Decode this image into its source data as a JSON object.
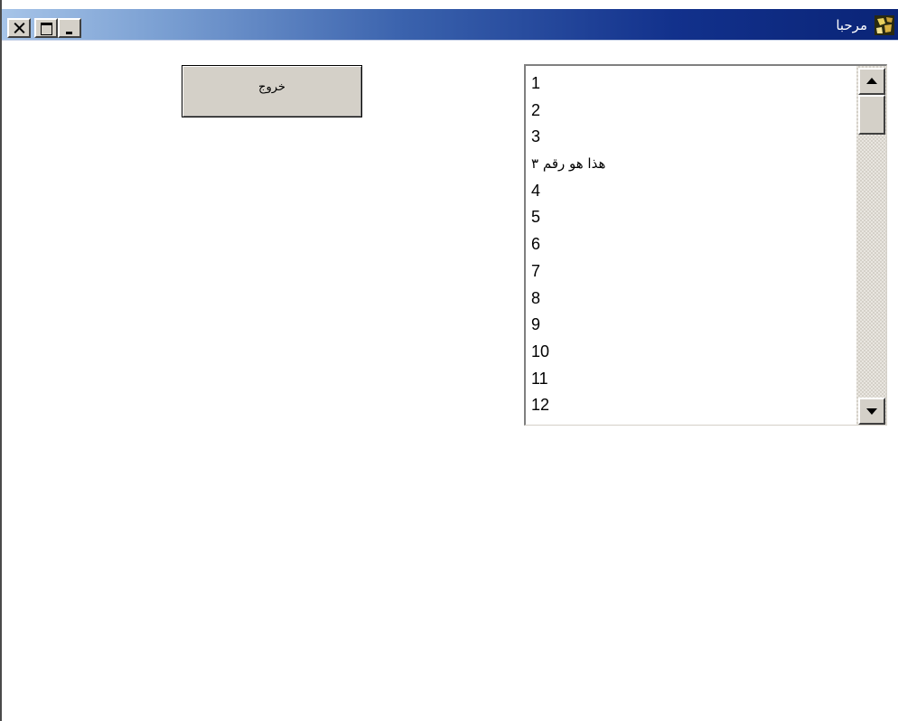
{
  "window": {
    "title": "مرحبا",
    "title_icon": "app-icon",
    "controls": {
      "close": "close-icon",
      "maximize": "maximize-icon",
      "minimize": "minimize-icon"
    },
    "colors": {
      "titlebar_start": "#a6c4e8",
      "titlebar_end": "#0a2477",
      "face": "#d4d0c8"
    }
  },
  "exit_button": {
    "label": "خروج"
  },
  "listbox": {
    "items": [
      "1",
      "2",
      "3",
      "هذا هو رقم ٣",
      "4",
      "5",
      "6",
      "7",
      "8",
      "9",
      "10",
      "11",
      "12"
    ],
    "scroll_position": 0
  }
}
